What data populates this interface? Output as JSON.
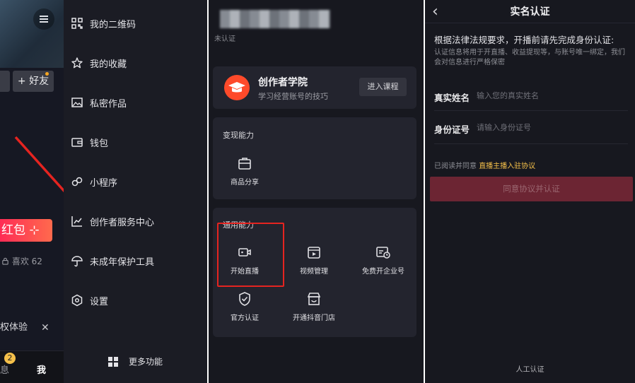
{
  "panel1": {
    "add_friend": "+ 好友",
    "red_packet": "红包 ⊹",
    "likes": "喜欢 62",
    "perm_tip": "权体验",
    "close": "✕",
    "tab_messages": "息",
    "tab_badge": "2",
    "tab_me": "我"
  },
  "drawer": {
    "items": [
      {
        "label": "我的二维码",
        "icon": "qr-code-icon"
      },
      {
        "label": "我的收藏",
        "icon": "star-icon"
      },
      {
        "label": "私密作品",
        "icon": "image-icon"
      },
      {
        "label": "钱包",
        "icon": "wallet-icon"
      },
      {
        "label": "小程序",
        "icon": "mini-program-icon"
      },
      {
        "label": "创作者服务中心",
        "icon": "chart-icon"
      },
      {
        "label": "未成年保护工具",
        "icon": "umbrella-icon"
      },
      {
        "label": "设置",
        "icon": "gear-icon"
      }
    ],
    "more": "更多功能"
  },
  "creator": {
    "status": "未认证",
    "academy_title": "创作者学院",
    "academy_subtitle": "学习经营账号的技巧",
    "course_button": "进入课程",
    "monetize_title": "变现能力",
    "monetize_items": [
      {
        "label": "商品分享",
        "icon": "bag-icon"
      }
    ],
    "general_title": "通用能力",
    "general_items": [
      {
        "label": "开始直播",
        "icon": "camera-icon"
      },
      {
        "label": "视频管理",
        "icon": "video-icon"
      },
      {
        "label": "免费开企业号",
        "icon": "enterprise-icon"
      },
      {
        "label": "官方认证",
        "icon": "shield-check-icon"
      },
      {
        "label": "开通抖音门店",
        "icon": "store-icon"
      }
    ]
  },
  "auth": {
    "title": "实名认证",
    "notice": "根据法律法规要求，开播前请先完成身份认证:",
    "info": "认证信息将用于开直播、收益提现等，与账号唯一绑定，我们会对信息进行严格保密",
    "name_label": "真实姓名",
    "name_placeholder": "输入您的真实姓名",
    "id_label": "身份证号",
    "id_placeholder": "请输入身份证号",
    "agree_prefix": "已阅读并同意",
    "agree_link": "直播主播入驻协议",
    "submit": "同意协议并认证",
    "manual": "人工认证"
  },
  "colors": {
    "accent": "#fe2c55",
    "highlight": "#e52420",
    "link": "#f5c04a",
    "background": "#17181f"
  }
}
